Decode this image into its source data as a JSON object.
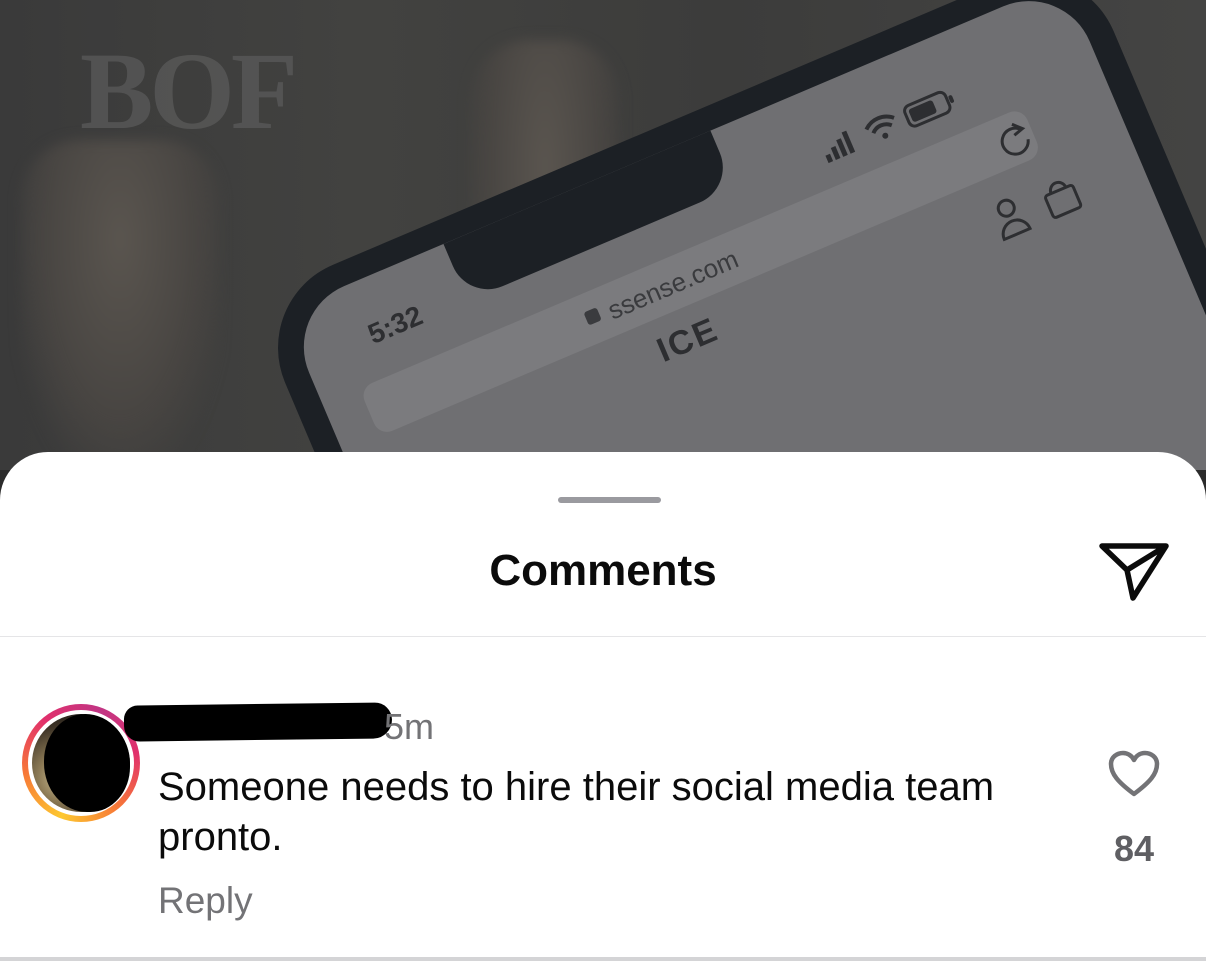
{
  "background_post": {
    "logo_text": "BOF",
    "phone": {
      "time": "5:32",
      "url": "ssense.com",
      "site_partial": "ICE"
    }
  },
  "sheet": {
    "title": "Comments",
    "share_icon": "paper-plane-icon"
  },
  "comment": {
    "username": "",
    "timestamp": "5m",
    "text": "Someone needs to hire their social media team pronto.",
    "reply_label": "Reply",
    "like_icon": "heart-outline-icon",
    "like_count": "84"
  },
  "colors": {
    "sheet_bg": "#ffffff",
    "text_primary": "#0b0b0b",
    "text_secondary": "#737376",
    "story_ring_start": "#fdc830",
    "story_ring_end": "#c13584"
  }
}
